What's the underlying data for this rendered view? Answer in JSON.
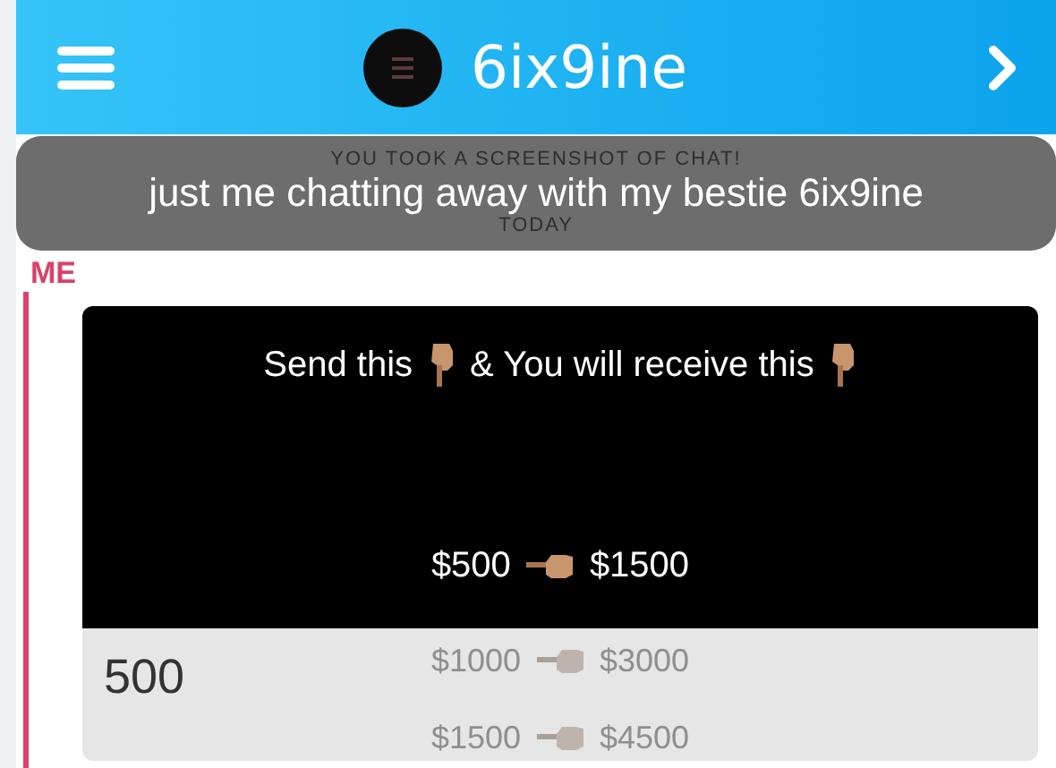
{
  "header": {
    "title": "6ix9ine"
  },
  "overlay": {
    "notice": "YOU TOOK A SCREENSHOT OF CHAT!",
    "caption": "just me chatting away with my bestie 6ix9ine",
    "date": "TODAY"
  },
  "messages": [
    {
      "sender": "ME",
      "color": "#d9426a",
      "kind": "snap",
      "snap": {
        "heading": [
          "Send this",
          "& You will receive this"
        ],
        "offers": [
          {
            "send": "$500",
            "receive": "$1500",
            "faded": false
          },
          {
            "send": "$1000",
            "receive": "$3000",
            "faded": true
          },
          {
            "send": "$1500",
            "receive": "$4500",
            "faded": true
          }
        ]
      },
      "text": "500"
    }
  ]
}
